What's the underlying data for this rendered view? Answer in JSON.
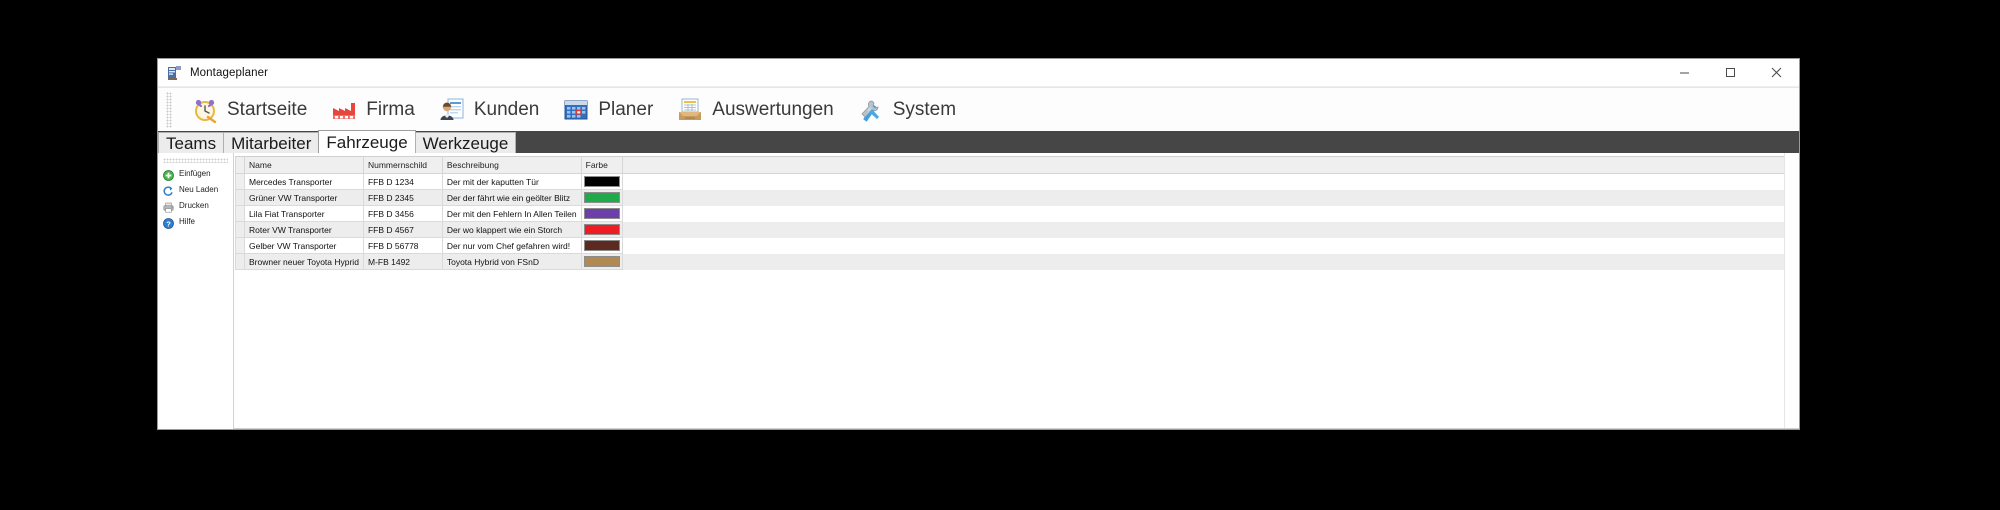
{
  "window": {
    "title": "Montageplaner",
    "icon": "app-icon",
    "controls": {
      "minimize": "—",
      "maximize": "□",
      "close": "✕"
    }
  },
  "ribbon": {
    "items": [
      {
        "label": "Startseite",
        "icon": "clock-icon"
      },
      {
        "label": "Firma",
        "icon": "factory-icon"
      },
      {
        "label": "Kunden",
        "icon": "customer-card-icon"
      },
      {
        "label": "Planer",
        "icon": "calendar-icon"
      },
      {
        "label": "Auswertungen",
        "icon": "inbox-tray-icon"
      },
      {
        "label": "System",
        "icon": "tools-icon"
      }
    ]
  },
  "tabs": [
    {
      "label": "Teams",
      "active": false
    },
    {
      "label": "Mitarbeiter",
      "active": false
    },
    {
      "label": "Fahrzeuge",
      "active": true
    },
    {
      "label": "Werkzeuge",
      "active": false
    }
  ],
  "sidebar": {
    "items": [
      {
        "label": "Einfügen",
        "icon": "plus-circle-icon"
      },
      {
        "label": "Neu Laden",
        "icon": "refresh-icon"
      },
      {
        "label": "Drucken",
        "icon": "printer-icon"
      },
      {
        "label": "Hilfe",
        "icon": "help-circle-icon"
      }
    ]
  },
  "table": {
    "columns": [
      "Name",
      "Nummernschild",
      "Beschreibung",
      "Farbe"
    ],
    "rows": [
      {
        "name": "Mercedes Transporter",
        "plate": "FFB D 1234",
        "description": "Der mit der kaputten Tür",
        "color": "#000000"
      },
      {
        "name": "Grüner VW Transporter",
        "plate": "FFB D 2345",
        "description": "Der der fährt wie ein geölter Blitz",
        "color": "#1faa4b"
      },
      {
        "name": "Lila Fiat Transporter",
        "plate": "FFB D 3456",
        "description": "Der mit den Fehlern In Allen Teilen",
        "color": "#6d3fa8"
      },
      {
        "name": "Roter VW Transporter",
        "plate": "FFB D 4567",
        "description": "Der wo klappert wie ein Storch",
        "color": "#ee1c25"
      },
      {
        "name": "Gelber VW Transporter",
        "plate": "FFB D 56778",
        "description": "Der nur vom Chef gefahren wird!",
        "color": "#5c2a21"
      },
      {
        "name": "Browner neuer Toyota Hyprid",
        "plate": "M-FB 1492",
        "description": "Toyota Hybrid von FSnD",
        "color": "#b08a52"
      }
    ]
  }
}
